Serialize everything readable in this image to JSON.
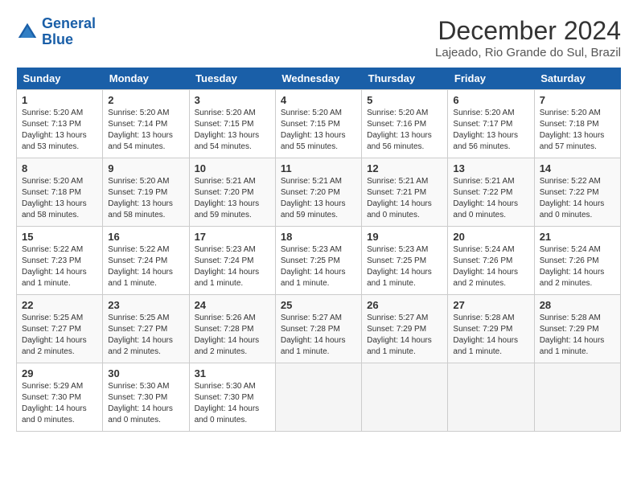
{
  "header": {
    "logo_line1": "General",
    "logo_line2": "Blue",
    "title": "December 2024",
    "location": "Lajeado, Rio Grande do Sul, Brazil"
  },
  "weekdays": [
    "Sunday",
    "Monday",
    "Tuesday",
    "Wednesday",
    "Thursday",
    "Friday",
    "Saturday"
  ],
  "weeks": [
    [
      {
        "day": 1,
        "info": "Sunrise: 5:20 AM\nSunset: 7:13 PM\nDaylight: 13 hours\nand 53 minutes."
      },
      {
        "day": 2,
        "info": "Sunrise: 5:20 AM\nSunset: 7:14 PM\nDaylight: 13 hours\nand 54 minutes."
      },
      {
        "day": 3,
        "info": "Sunrise: 5:20 AM\nSunset: 7:15 PM\nDaylight: 13 hours\nand 54 minutes."
      },
      {
        "day": 4,
        "info": "Sunrise: 5:20 AM\nSunset: 7:15 PM\nDaylight: 13 hours\nand 55 minutes."
      },
      {
        "day": 5,
        "info": "Sunrise: 5:20 AM\nSunset: 7:16 PM\nDaylight: 13 hours\nand 56 minutes."
      },
      {
        "day": 6,
        "info": "Sunrise: 5:20 AM\nSunset: 7:17 PM\nDaylight: 13 hours\nand 56 minutes."
      },
      {
        "day": 7,
        "info": "Sunrise: 5:20 AM\nSunset: 7:18 PM\nDaylight: 13 hours\nand 57 minutes."
      }
    ],
    [
      {
        "day": 8,
        "info": "Sunrise: 5:20 AM\nSunset: 7:18 PM\nDaylight: 13 hours\nand 58 minutes."
      },
      {
        "day": 9,
        "info": "Sunrise: 5:20 AM\nSunset: 7:19 PM\nDaylight: 13 hours\nand 58 minutes."
      },
      {
        "day": 10,
        "info": "Sunrise: 5:21 AM\nSunset: 7:20 PM\nDaylight: 13 hours\nand 59 minutes."
      },
      {
        "day": 11,
        "info": "Sunrise: 5:21 AM\nSunset: 7:20 PM\nDaylight: 13 hours\nand 59 minutes."
      },
      {
        "day": 12,
        "info": "Sunrise: 5:21 AM\nSunset: 7:21 PM\nDaylight: 14 hours\nand 0 minutes."
      },
      {
        "day": 13,
        "info": "Sunrise: 5:21 AM\nSunset: 7:22 PM\nDaylight: 14 hours\nand 0 minutes."
      },
      {
        "day": 14,
        "info": "Sunrise: 5:22 AM\nSunset: 7:22 PM\nDaylight: 14 hours\nand 0 minutes."
      }
    ],
    [
      {
        "day": 15,
        "info": "Sunrise: 5:22 AM\nSunset: 7:23 PM\nDaylight: 14 hours\nand 1 minute."
      },
      {
        "day": 16,
        "info": "Sunrise: 5:22 AM\nSunset: 7:24 PM\nDaylight: 14 hours\nand 1 minute."
      },
      {
        "day": 17,
        "info": "Sunrise: 5:23 AM\nSunset: 7:24 PM\nDaylight: 14 hours\nand 1 minute."
      },
      {
        "day": 18,
        "info": "Sunrise: 5:23 AM\nSunset: 7:25 PM\nDaylight: 14 hours\nand 1 minute."
      },
      {
        "day": 19,
        "info": "Sunrise: 5:23 AM\nSunset: 7:25 PM\nDaylight: 14 hours\nand 1 minute."
      },
      {
        "day": 20,
        "info": "Sunrise: 5:24 AM\nSunset: 7:26 PM\nDaylight: 14 hours\nand 2 minutes."
      },
      {
        "day": 21,
        "info": "Sunrise: 5:24 AM\nSunset: 7:26 PM\nDaylight: 14 hours\nand 2 minutes."
      }
    ],
    [
      {
        "day": 22,
        "info": "Sunrise: 5:25 AM\nSunset: 7:27 PM\nDaylight: 14 hours\nand 2 minutes."
      },
      {
        "day": 23,
        "info": "Sunrise: 5:25 AM\nSunset: 7:27 PM\nDaylight: 14 hours\nand 2 minutes."
      },
      {
        "day": 24,
        "info": "Sunrise: 5:26 AM\nSunset: 7:28 PM\nDaylight: 14 hours\nand 2 minutes."
      },
      {
        "day": 25,
        "info": "Sunrise: 5:27 AM\nSunset: 7:28 PM\nDaylight: 14 hours\nand 1 minute."
      },
      {
        "day": 26,
        "info": "Sunrise: 5:27 AM\nSunset: 7:29 PM\nDaylight: 14 hours\nand 1 minute."
      },
      {
        "day": 27,
        "info": "Sunrise: 5:28 AM\nSunset: 7:29 PM\nDaylight: 14 hours\nand 1 minute."
      },
      {
        "day": 28,
        "info": "Sunrise: 5:28 AM\nSunset: 7:29 PM\nDaylight: 14 hours\nand 1 minute."
      }
    ],
    [
      {
        "day": 29,
        "info": "Sunrise: 5:29 AM\nSunset: 7:30 PM\nDaylight: 14 hours\nand 0 minutes."
      },
      {
        "day": 30,
        "info": "Sunrise: 5:30 AM\nSunset: 7:30 PM\nDaylight: 14 hours\nand 0 minutes."
      },
      {
        "day": 31,
        "info": "Sunrise: 5:30 AM\nSunset: 7:30 PM\nDaylight: 14 hours\nand 0 minutes."
      },
      {
        "day": null
      },
      {
        "day": null
      },
      {
        "day": null
      },
      {
        "day": null
      }
    ]
  ]
}
